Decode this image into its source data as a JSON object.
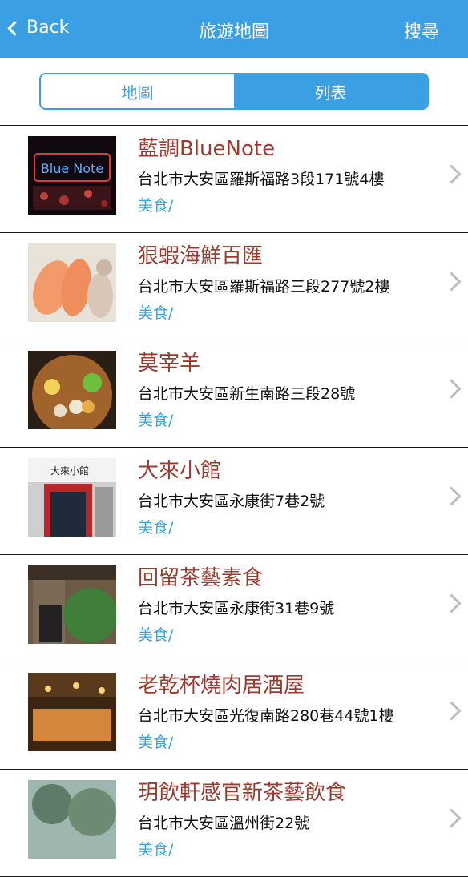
{
  "header": {
    "back_label": "Back",
    "title": "旅遊地圖",
    "search_label": "搜尋"
  },
  "segment": {
    "map_label": "地圖",
    "list_label": "列表",
    "selected": "list"
  },
  "items": [
    {
      "name": "藍調BlueNote",
      "address": "台北市大安區羅斯福路3段171號4樓",
      "category": "美食/",
      "thumb_sign": "Blue Note"
    },
    {
      "name": "狠蝦海鮮百匯",
      "address": "台北市大安區羅斯福路三段277號2樓",
      "category": "美食/"
    },
    {
      "name": "莫宰羊",
      "address": "台北市大安區新生南路三段28號",
      "category": "美食/"
    },
    {
      "name": "大來小館",
      "address": "台北市大安區永康街7巷2號",
      "category": "美食/",
      "thumb_sign": "大來小館"
    },
    {
      "name": "回留茶藝素食",
      "address": "台北市大安區永康街31巷9號",
      "category": "美食/"
    },
    {
      "name": "老乾杯燒肉居酒屋",
      "address": "台北市大安區光復南路280巷44號1樓",
      "category": "美食/"
    },
    {
      "name": "玥飲軒感官新茶藝飲食",
      "address": "台北市大安區溫州街22號",
      "category": "美食/"
    }
  ],
  "colors": {
    "primary": "#3a9fe3",
    "name": "#9b3a2e",
    "category": "#3aa0d8",
    "arrow": "#bdbdbd"
  }
}
